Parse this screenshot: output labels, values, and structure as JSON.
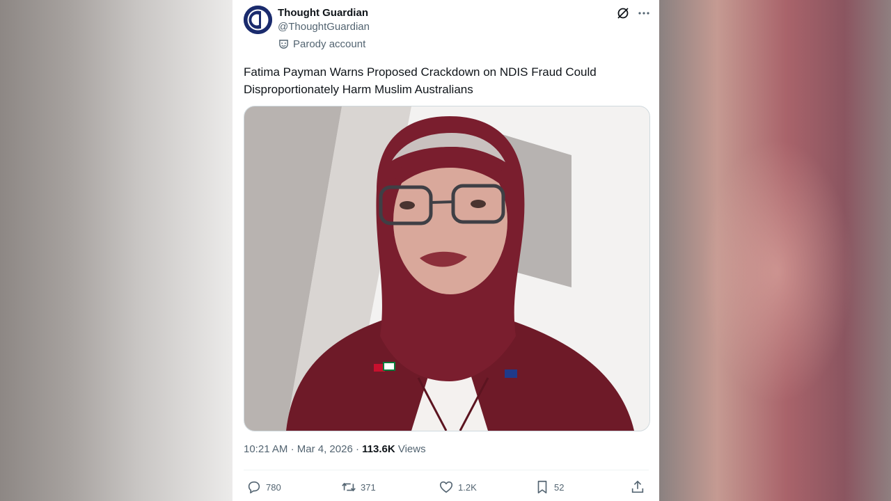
{
  "post": {
    "author_name": "Thought Guardian",
    "author_handle": "@ThoughtGuardian",
    "account_label": "Parody account",
    "text": "Fatima Payman Warns Proposed Crackdown on NDIS Fraud Could Disproportionately Harm Muslim Australians",
    "time": "10:21 AM",
    "date": "Mar 4, 2026",
    "views_count": "113.6K",
    "views_label": "Views"
  },
  "actions": {
    "replies": "780",
    "reposts": "371",
    "likes": "1.2K",
    "bookmarks": "52"
  },
  "icons": {
    "avatar": "newspaper-logo-icon",
    "parody": "theater-mask-icon",
    "grok": "grok-icon",
    "more": "more-dots-icon",
    "reply": "reply-icon",
    "repost": "repost-icon",
    "like": "heart-icon",
    "bookmark": "bookmark-icon",
    "share": "share-icon"
  },
  "colors": {
    "text": "#0f1419",
    "secondary": "#536471",
    "avatar_bg": "#1a2b6d",
    "hijab": "#7a1e2e"
  }
}
